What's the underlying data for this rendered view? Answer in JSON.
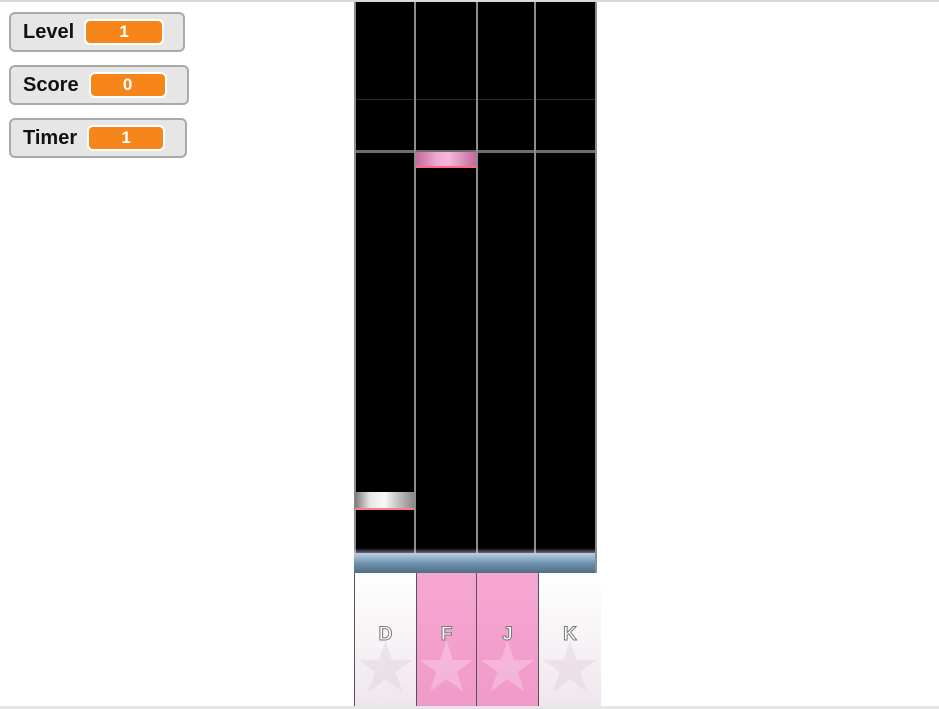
{
  "monitors": [
    {
      "label": "Level",
      "value": "1"
    },
    {
      "label": "Score",
      "value": "0"
    },
    {
      "label": "Timer",
      "value": "1"
    }
  ],
  "lanes": [
    {
      "key": "D",
      "pressed": false
    },
    {
      "key": "F",
      "pressed": true
    },
    {
      "key": "J",
      "pressed": true
    },
    {
      "key": "K",
      "pressed": false
    }
  ],
  "notes": [
    {
      "lane": 2,
      "color": "pink"
    },
    {
      "lane": 1,
      "color": "white"
    }
  ],
  "colors": {
    "monitor_value_bg": "#f7861a",
    "key_pressed": "#f09ac9",
    "playfield": "#000000"
  }
}
